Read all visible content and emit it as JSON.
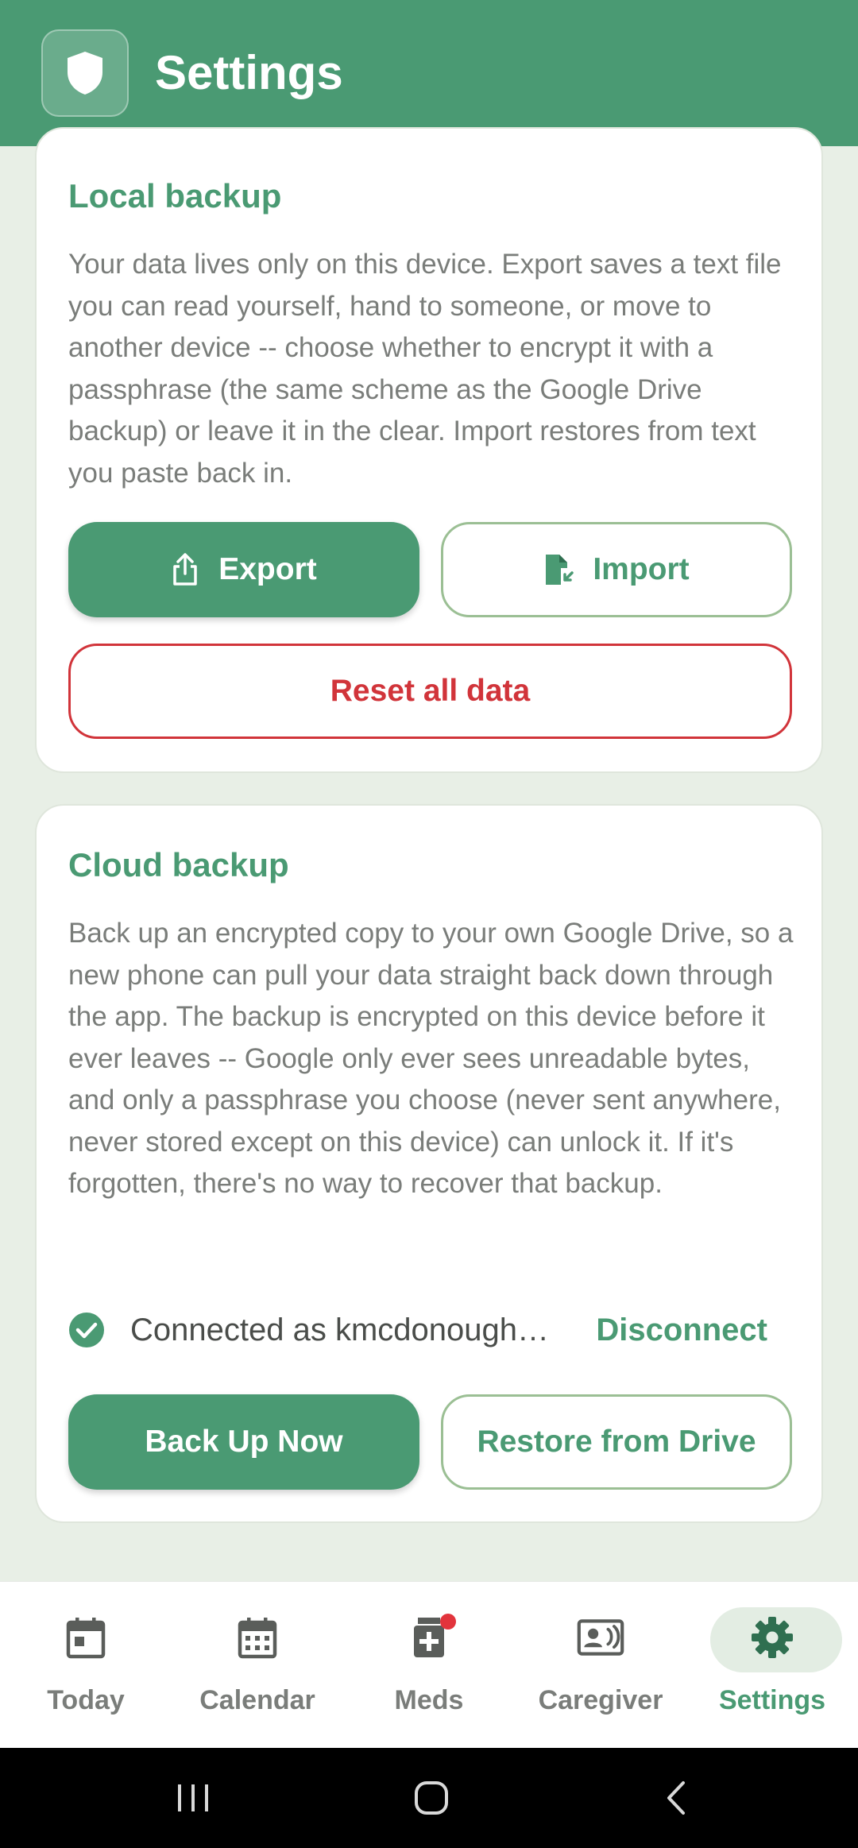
{
  "header": {
    "title": "Settings",
    "badge_icon": "shield-icon"
  },
  "local_backup": {
    "title": "Local backup",
    "description": "Your data lives only on this device. Export saves a text file you can read yourself, hand to someone, or move to another device -- choose whether to encrypt it with a passphrase (the same scheme as the Google Drive backup) or leave it in the clear. Import restores from text you paste back in.",
    "export_label": "Export",
    "import_label": "Import",
    "reset_label": "Reset all data"
  },
  "cloud_backup": {
    "title": "Cloud backup",
    "description": "Back up an encrypted copy to your own Google Drive, so a new phone can pull your data straight back down through the app. The backup is encrypted on this device before it ever leaves -- Google only ever sees unreadable bytes, and only a passphrase you choose (never sent anywhere, never stored except on this device) can unlock it. If it's forgotten, there's no way to recover that backup.",
    "connected_text": "Connected as kmcdonough…",
    "disconnect_label": "Disconnect",
    "backup_now_label": "Back Up Now",
    "restore_label": "Restore from Drive"
  },
  "bottom_nav": {
    "items": [
      {
        "label": "Today",
        "icon": "calendar-today-icon",
        "active": false
      },
      {
        "label": "Calendar",
        "icon": "calendar-month-icon",
        "active": false
      },
      {
        "label": "Meds",
        "icon": "medication-icon",
        "active": false,
        "badge": true
      },
      {
        "label": "Caregiver",
        "icon": "contact-card-icon",
        "active": false
      },
      {
        "label": "Settings",
        "icon": "gear-icon",
        "active": true
      }
    ]
  },
  "colors": {
    "primary": "#4a9a73",
    "danger": "#d1343a",
    "background": "#e8efe6",
    "badge": "#e2343c"
  }
}
